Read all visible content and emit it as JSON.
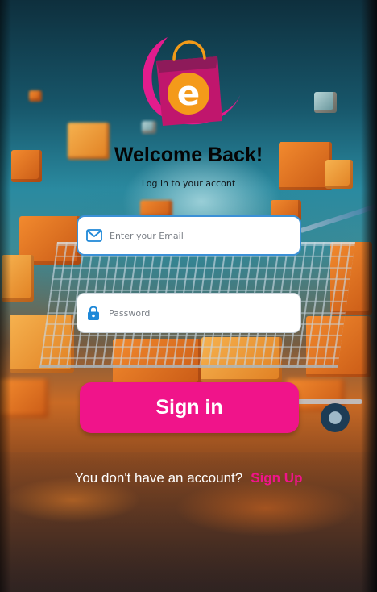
{
  "logo": {
    "letter": "e"
  },
  "header": {
    "title": "Welcome Back!",
    "subtitle": "Log in to your accont"
  },
  "form": {
    "email": {
      "icon": "mail-icon",
      "placeholder": "Enter your Email",
      "value": ""
    },
    "password": {
      "icon": "lock-icon",
      "placeholder": "Password",
      "value": ""
    },
    "submit_label": "Sign in"
  },
  "footer": {
    "prompt": "You don't have an account?",
    "signup_label": "Sign Up"
  },
  "colors": {
    "accent": "#f0148a",
    "input_focus_border": "#3b90d6",
    "icon": "#1e88d8",
    "title": "#050505"
  }
}
